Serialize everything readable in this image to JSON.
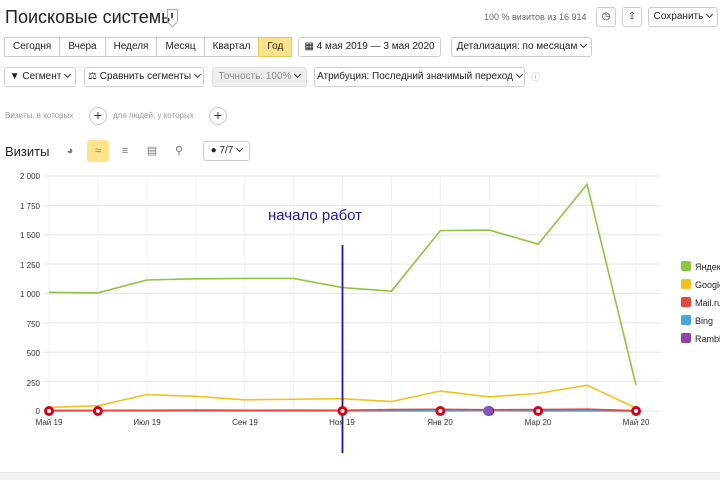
{
  "header": {
    "title": "Поисковые системы",
    "visits_note": "100 % визитов из 16 914",
    "save_label": "Сохранить"
  },
  "period": {
    "buttons": [
      "Сегодня",
      "Вчера",
      "Неделя",
      "Месяц",
      "Квартал",
      "Год"
    ],
    "selected": "Год",
    "date_range": "4 мая 2019 — 3 мая 2020",
    "detail": "Детализация: по месяцам"
  },
  "toolbar": {
    "segment": "Сегмент",
    "compare": "Сравнить сегменты",
    "accuracy": "Точность: 100%",
    "attribution": "Атрибуция: Последний значимый переход"
  },
  "filters": {
    "visits_where": "Визиты, в которых",
    "people_where": "для людей, у которых"
  },
  "graph_controls": {
    "label": "Визиты",
    "series_count": "7/7"
  },
  "annotation": "начало работ",
  "colors": {
    "yandex": "#8cc63f",
    "google": "#f3c11b",
    "mail": "#e8453c",
    "bing": "#4aa3df",
    "rambler": "#8e44ad",
    "marker": "#d0021b",
    "annotation_line": "#1a1aa0"
  },
  "chart_data": {
    "type": "line",
    "x": [
      "Май 19",
      "Июн 19",
      "Июл 19",
      "Авг 19",
      "Сен 19",
      "Окт 19",
      "Ноя 19",
      "Дек 19",
      "Янв 20",
      "Фев 20",
      "Мар 20",
      "Апр 20",
      "Май 20"
    ],
    "xtick_labels": [
      "Май 19",
      "Июл 19",
      "Сен 19",
      "Ноя 19",
      "Янв 20",
      "Мар 20",
      "Май 20"
    ],
    "ylim": [
      0,
      2000
    ],
    "yticks": [
      "2 000",
      "1 750",
      "1 500",
      "1 250",
      "1 000",
      "750",
      "500",
      "250",
      "0"
    ],
    "grid": true,
    "legend_position": "right",
    "series": [
      {
        "name": "Яндекс",
        "key": "yandex",
        "values": [
          1010,
          1005,
          1115,
          1125,
          1128,
          1128,
          1050,
          1020,
          1535,
          1540,
          1420,
          1930,
          220
        ]
      },
      {
        "name": "Google",
        "key": "google",
        "values": [
          30,
          45,
          140,
          125,
          95,
          100,
          105,
          80,
          170,
          120,
          150,
          220,
          25
        ]
      },
      {
        "name": "Mail.ru",
        "key": "mail",
        "values": [
          5,
          5,
          6,
          8,
          6,
          7,
          6,
          12,
          15,
          10,
          12,
          15,
          3
        ]
      },
      {
        "name": "Bing",
        "key": "bing",
        "values": [
          2,
          3,
          2,
          2,
          3,
          2,
          3,
          5,
          4,
          3,
          6,
          4,
          1
        ]
      },
      {
        "name": "Rambler",
        "key": "rambler",
        "values": [
          1,
          1,
          1,
          2,
          1,
          1,
          1,
          2,
          2,
          3,
          1,
          2,
          0
        ]
      }
    ],
    "legend": [
      "Яндекс",
      "Google",
      "Mail.ru",
      "Bing",
      "Rambler"
    ],
    "annotation_at": "Ноя 19"
  }
}
